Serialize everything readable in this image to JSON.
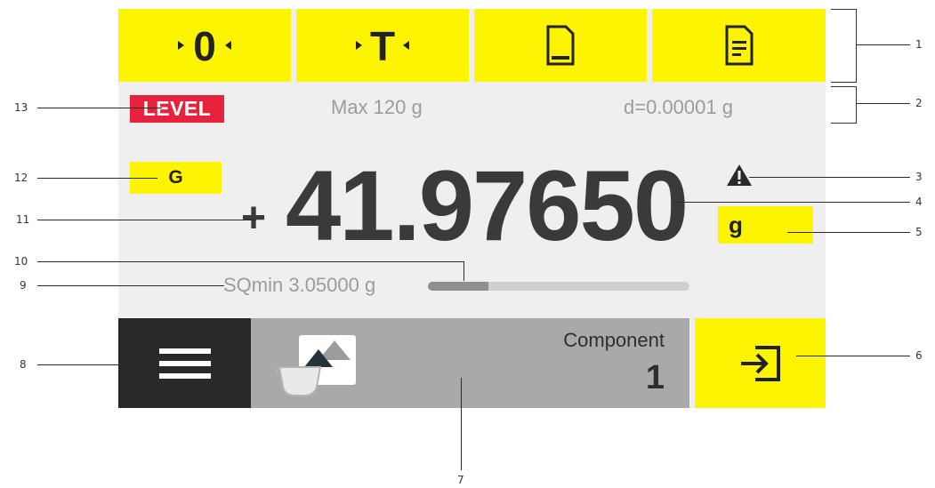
{
  "top_buttons": [
    {
      "label": "•0•",
      "icon": "zero-icon"
    },
    {
      "label": "•T•",
      "icon": "tare-icon"
    },
    {
      "label": "",
      "icon": "single-document-icon"
    },
    {
      "label": "",
      "icon": "document-lines-icon"
    }
  ],
  "status": {
    "level_label": "LEVEL",
    "max_capacity": "Max 120 g",
    "readability": "d=0.00001 g"
  },
  "weighing": {
    "mode_badge": "G",
    "sign": "+",
    "value": "41.97650",
    "unit": "g",
    "warning_icon": "warning-triangle-icon",
    "sqmin_label": "SQmin 3.05000 g",
    "sqmin_progress": 0.23
  },
  "bottom": {
    "menu_icon": "hamburger-menu-icon",
    "component_label": "Component",
    "component_number": "1",
    "enter_icon": "enter-icon"
  },
  "callouts": [
    "1",
    "2",
    "3",
    "4",
    "5",
    "6",
    "7",
    "8",
    "9",
    "10",
    "11",
    "12",
    "13"
  ],
  "colors": {
    "accent_yellow": "#fcf400",
    "level_red": "#e6223d",
    "screen_bg": "#efefef",
    "menu_dark": "#2a2728",
    "component_gray": "#a9a9a9"
  }
}
